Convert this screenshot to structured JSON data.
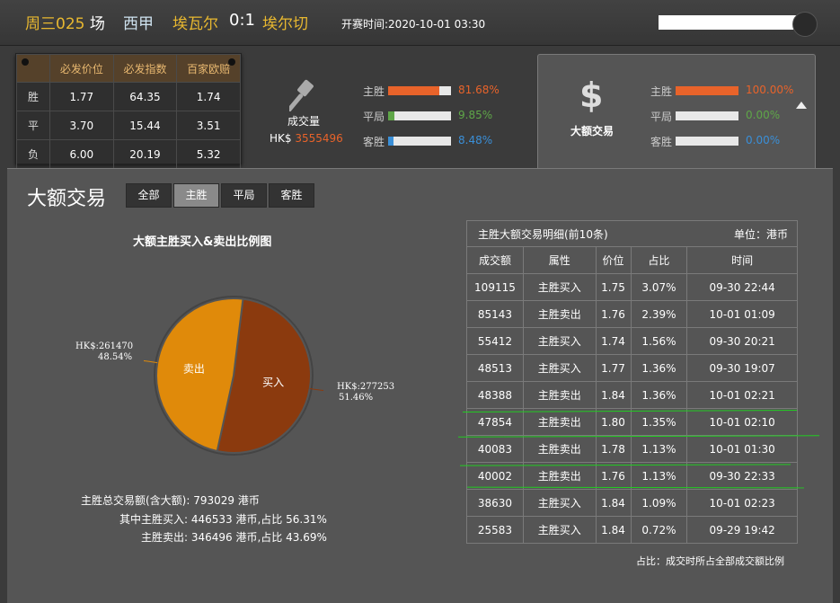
{
  "header": {
    "match_code": "周三025",
    "match_code_suffix": "场",
    "league": "西甲",
    "home_team": "埃瓦尔",
    "score": "0:1",
    "away_team": "埃尔切",
    "kickoff": "开赛时间:2020-10-01 03:30"
  },
  "odds_table": {
    "columns": [
      "必发价位",
      "必发指数",
      "百家欧赔"
    ],
    "rows": [
      {
        "label": "胜",
        "values": [
          "1.77",
          "64.35",
          "1.74"
        ]
      },
      {
        "label": "平",
        "values": [
          "3.70",
          "15.44",
          "3.51"
        ]
      },
      {
        "label": "负",
        "values": [
          "6.00",
          "20.19",
          "5.32"
        ]
      }
    ]
  },
  "volume": {
    "icon": "gavel-icon",
    "label": "成交量",
    "currency": "HK$",
    "value": "3555496",
    "bars": [
      {
        "label": "主胜",
        "percent": "81.68%",
        "fraction": 0.8168,
        "color": "#e8632a"
      },
      {
        "label": "平局",
        "percent": "9.85%",
        "fraction": 0.0985,
        "color": "#5fa648"
      },
      {
        "label": "客胜",
        "percent": "8.48%",
        "fraction": 0.0848,
        "color": "#3a8fd8"
      }
    ]
  },
  "big_trade_tab": {
    "icon": "dollar-icon",
    "label": "大额交易",
    "bars": [
      {
        "label": "主胜",
        "percent": "100.00%",
        "fraction": 1.0,
        "color": "#e8632a"
      },
      {
        "label": "平局",
        "percent": "0.00%",
        "fraction": 0.0,
        "color": "#5fa648"
      },
      {
        "label": "客胜",
        "percent": "0.00%",
        "fraction": 0.0,
        "color": "#3a8fd8"
      }
    ]
  },
  "panel": {
    "title": "大额交易",
    "filters": [
      "全部",
      "主胜",
      "平局",
      "客胜"
    ],
    "active_filter": "主胜",
    "chart_title": "大额主胜买入&卖出比例图",
    "summary": {
      "total": "主胜总交易额(含大额): 793029 港币",
      "buy": "其中主胜买入: 446533 港币,占比 56.31%",
      "sell": "主胜卖出: 346496 港币,占比 43.69%"
    },
    "footnote": "占比：成交时所占全部成交额比例"
  },
  "chart_data": {
    "type": "pie",
    "title": "大额主胜买入&卖出比例图",
    "slices": [
      {
        "name": "买入",
        "value": 277253,
        "value_label": "HK$:277253",
        "percent": 51.46,
        "percent_label": "51.46%",
        "color": "#8b3a0e"
      },
      {
        "name": "卖出",
        "value": 261470,
        "value_label": "HK$:261470",
        "percent": 48.54,
        "percent_label": "48.54%",
        "color": "#e08a0a"
      }
    ]
  },
  "detail_table": {
    "title": "主胜大额交易明细(前10条)",
    "unit": "单位：港币",
    "columns": [
      "成交额",
      "属性",
      "价位",
      "占比",
      "时间"
    ],
    "rows": [
      [
        "109115",
        "主胜买入",
        "1.75",
        "3.07%",
        "09-30 22:44"
      ],
      [
        "85143",
        "主胜卖出",
        "1.76",
        "2.39%",
        "10-01 01:09"
      ],
      [
        "55412",
        "主胜买入",
        "1.74",
        "1.56%",
        "09-30 20:21"
      ],
      [
        "48513",
        "主胜买入",
        "1.77",
        "1.36%",
        "09-30 19:07"
      ],
      [
        "48388",
        "主胜卖出",
        "1.84",
        "1.36%",
        "10-01 02:21"
      ],
      [
        "47854",
        "主胜卖出",
        "1.80",
        "1.35%",
        "10-01 02:10"
      ],
      [
        "40083",
        "主胜卖出",
        "1.78",
        "1.13%",
        "10-01 01:30"
      ],
      [
        "40002",
        "主胜卖出",
        "1.76",
        "1.13%",
        "09-30 22:33"
      ],
      [
        "38630",
        "主胜买入",
        "1.84",
        "1.09%",
        "10-01 02:23"
      ],
      [
        "25583",
        "主胜买入",
        "1.84",
        "0.72%",
        "09-29 19:42"
      ]
    ]
  }
}
